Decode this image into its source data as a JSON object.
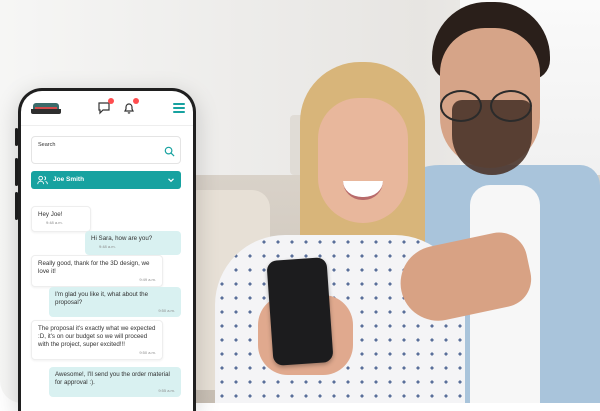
{
  "app": {
    "search": {
      "label": "Search"
    },
    "contact": {
      "name": "Joe Smith"
    },
    "messages": [
      {
        "direction": "in",
        "text": "Hey Joe!",
        "time": "9:48 a.m."
      },
      {
        "direction": "out",
        "text": "Hi Sara, how are you?",
        "time": "9:48 a.m."
      },
      {
        "direction": "in",
        "text": "Really good, thank for the 3D design, we love it!",
        "time": "9:49 a.m."
      },
      {
        "direction": "out",
        "text": "I'm glad you like it, what about the proposal?",
        "time": "9:50 a.m."
      },
      {
        "direction": "in",
        "text": "The proposal it's exactly what we expected :D, it's on our budget so we will proceed with the project, super excited!!!",
        "time": "9:50 a.m."
      },
      {
        "direction": "out",
        "text": "Awesome!, I'll send you the order material for approval :).",
        "time": "9:55 a.m."
      }
    ],
    "icons": {
      "logo": "company-logo",
      "chat": "chat-bubble-icon",
      "bell": "bell-icon",
      "menu": "hamburger-menu-icon",
      "search": "search-icon",
      "contact": "users-icon",
      "caret": "chevron-down-icon"
    },
    "colors": {
      "accent": "#17a2a0",
      "outgoing_bubble": "#d9f1f1",
      "notification": "#ff4d4f"
    }
  }
}
